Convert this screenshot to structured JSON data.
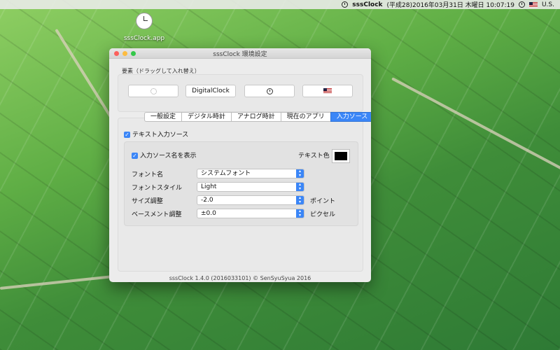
{
  "menubar": {
    "app_name": "sssClock",
    "datetime": "(平成28)2016年03月31日 木曜日 10:07:19",
    "input_source": "U.S."
  },
  "desktop": {
    "icon_label": "sssClock.app"
  },
  "window": {
    "title": "sssClock 環境設定",
    "section_caption": "要素（ドラッグして入れ替え）",
    "items": [
      "",
      "DigitalClock",
      "",
      ""
    ],
    "tabs": [
      "一般設定",
      "デジタル時計",
      "アナログ時計",
      "現在のアプリ",
      "入力ソース"
    ],
    "active_tab": "入力ソース",
    "panel": {
      "text_input_source_label": "テキスト入力ソース",
      "show_name_label": "入力ソース名を表示",
      "text_color_label": "テキスト色",
      "text_color": "#000000",
      "rows": [
        {
          "label": "フォント名",
          "value": "システムフォント",
          "unit": ""
        },
        {
          "label": "フォントスタイル",
          "value": "Light",
          "unit": ""
        },
        {
          "label": "サイズ調整",
          "value": "-2.0",
          "unit": "ポイント"
        },
        {
          "label": "ベースメント調整",
          "value": "±0.0",
          "unit": "ピクセル"
        }
      ]
    },
    "footer": "sssClock 1.4.0 (2016033101) © SenSyuSyua 2016"
  },
  "colors": {
    "accent": "#3b86f7",
    "close": "#fc605c",
    "minimize": "#fdbc40",
    "zoom": "#34c84a"
  }
}
